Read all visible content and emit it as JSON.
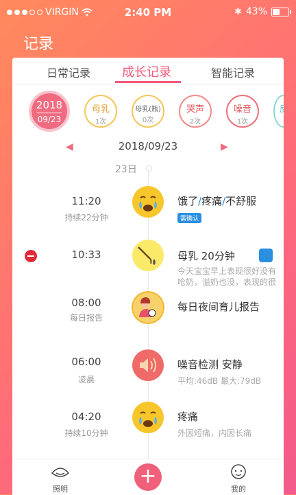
{
  "status": {
    "carrier": "VIRGIN",
    "time": "2:40 PM",
    "battery": "43%"
  },
  "header": {
    "title": "记录"
  },
  "tabs": [
    {
      "label": "日常记录",
      "active": false
    },
    {
      "label": "成长记录",
      "active": true
    },
    {
      "label": "智能记录",
      "active": false
    }
  ],
  "today": {
    "year": "2018",
    "md": "09/23"
  },
  "stats": [
    {
      "label": "母乳",
      "count": "1次"
    },
    {
      "label": "母乳(瓶)",
      "count": "0次"
    },
    {
      "label": "哭声",
      "count": "2次"
    },
    {
      "label": "噪音",
      "count": "1次"
    },
    {
      "label": "反",
      "count": ""
    }
  ],
  "date_nav": {
    "date": "2018/09/23"
  },
  "day": "23日",
  "entries": [
    {
      "time": "11:20",
      "sub": "持续22分钟",
      "title_a": "饿了",
      "title_b": "疼痛",
      "title_c": "不舒服",
      "badge": "需确认"
    },
    {
      "time": "10:33",
      "sub": "",
      "title": "母乳  20分钟",
      "detail1": "今天宝宝早上表现很好没有",
      "detail2": "呛奶，溢奶也没，表现的很"
    },
    {
      "time": "08:00",
      "sub": "每日报告",
      "title": "每日夜间育儿报告"
    },
    {
      "time": "06:00",
      "sub": "凌晨",
      "title": "噪音检测  安静",
      "detail1": "平均:46dB    最大:79dB"
    },
    {
      "time": "04:20",
      "sub": "持续10分钟",
      "title": "疼痛",
      "detail1": "外因短痛，内因长痛"
    }
  ],
  "tabbar": {
    "left_label": "照明",
    "right_label": "我的"
  },
  "colors": {
    "accent": "#f06a80",
    "blue": "#2a8fe0"
  }
}
